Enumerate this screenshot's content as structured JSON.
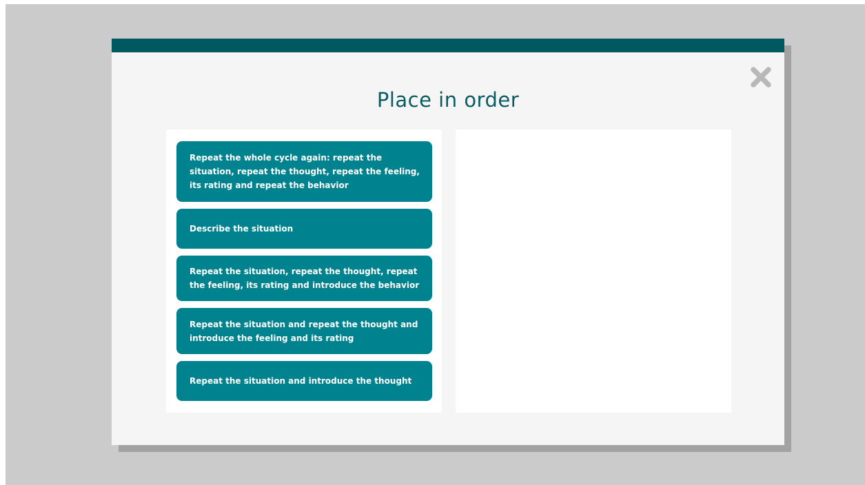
{
  "dialog": {
    "title": "Place in order",
    "accent_color": "#005961",
    "card_color": "#00838f"
  },
  "close_button": {
    "icon": "close-icon"
  },
  "cards": [
    {
      "text": "Repeat the whole cycle again: repeat the situation, repeat the thought, repeat the feeling, its rating and repeat the behavior"
    },
    {
      "text": "Describe the situation"
    },
    {
      "text": "Repeat the situation, repeat the thought, repeat the feeling, its rating and introduce the behavior"
    },
    {
      "text": "Repeat the situation and repeat the thought and introduce the feeling and its rating"
    },
    {
      "text": "Repeat the situation and introduce the thought"
    }
  ]
}
